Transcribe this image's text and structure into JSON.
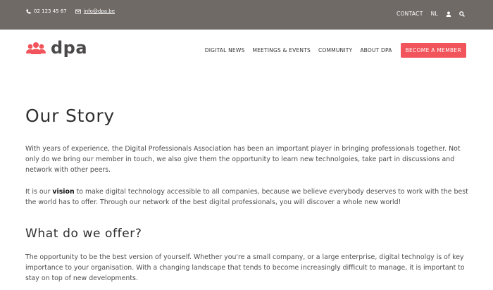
{
  "topbar": {
    "phone": "02 123 45 67",
    "email": "info@dpa.be",
    "contact": "CONTACT",
    "lang": "NL",
    "colors": {
      "background": "#6f6a66"
    }
  },
  "header": {
    "logo_text": "dpa",
    "nav": {
      "digital_news": "DIGITAL NEWS",
      "meetings_events": "MEETINGS & EVENTS",
      "community": "COMMUNITY",
      "about": "ABOUT DPA",
      "member_button": "BECOME A MEMBER"
    },
    "colors": {
      "accent": "#f2545b"
    }
  },
  "main": {
    "title": "Our Story",
    "intro": "With years of experience, the Digital Professionals Association has been an important player in bringing professionals together. Not only do we bring our member in touch, we also give them the opportunity to learn new technolgoies, take part in discussions and network with other peers.",
    "vision_before": "It is our ",
    "vision_word": "vision",
    "vision_after": " to make digital technology accessible to all companies, because we believe everybody deserves to work with the best the world has to offer. Through our network of the best digital professionals, you will discover a whole new world!",
    "subtitle": "What do we offer?",
    "offer": "The opportunity to be the best version of yourself. Whether you're a small company, or a large enterprise, digital technolgy is of key importance to your organisation. With a changing landscape that tends to become increasingly difficult to manage, it is important to stay on top of new developments."
  }
}
